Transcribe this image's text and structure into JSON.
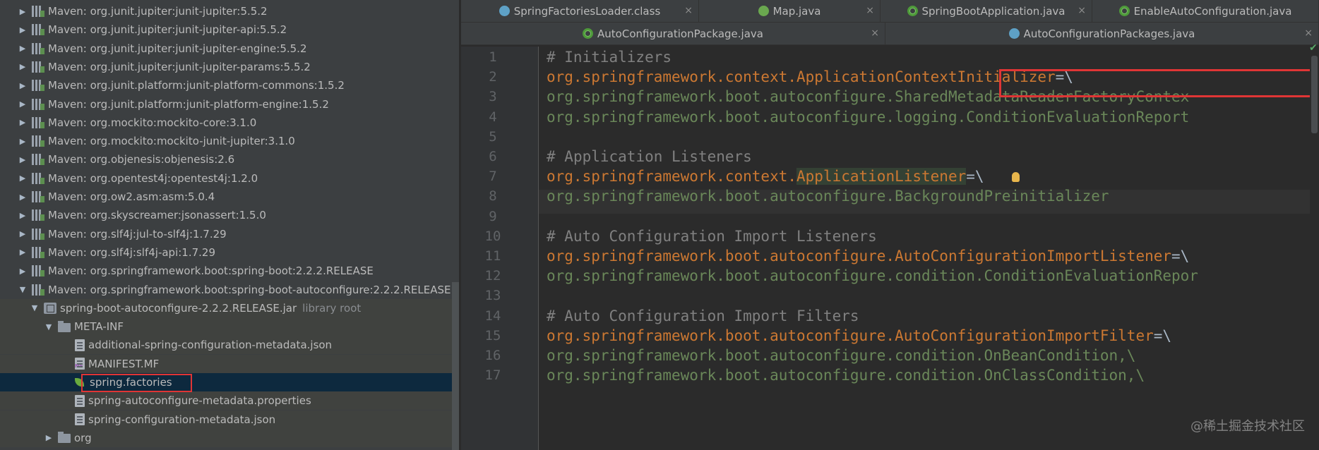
{
  "project_tree": {
    "rows": [
      {
        "label": "Maven: org.junit.jupiter:junit-jupiter:5.5.2",
        "depth": 1,
        "arrow": "▶",
        "icon": "library-icon"
      },
      {
        "label": "Maven: org.junit.jupiter:junit-jupiter-api:5.5.2",
        "depth": 1,
        "arrow": "▶",
        "icon": "library-icon"
      },
      {
        "label": "Maven: org.junit.jupiter:junit-jupiter-engine:5.5.2",
        "depth": 1,
        "arrow": "▶",
        "icon": "library-icon"
      },
      {
        "label": "Maven: org.junit.jupiter:junit-jupiter-params:5.5.2",
        "depth": 1,
        "arrow": "▶",
        "icon": "library-icon"
      },
      {
        "label": "Maven: org.junit.platform:junit-platform-commons:1.5.2",
        "depth": 1,
        "arrow": "▶",
        "icon": "library-icon"
      },
      {
        "label": "Maven: org.junit.platform:junit-platform-engine:1.5.2",
        "depth": 1,
        "arrow": "▶",
        "icon": "library-icon"
      },
      {
        "label": "Maven: org.mockito:mockito-core:3.1.0",
        "depth": 1,
        "arrow": "▶",
        "icon": "library-icon"
      },
      {
        "label": "Maven: org.mockito:mockito-junit-jupiter:3.1.0",
        "depth": 1,
        "arrow": "▶",
        "icon": "library-icon"
      },
      {
        "label": "Maven: org.objenesis:objenesis:2.6",
        "depth": 1,
        "arrow": "▶",
        "icon": "library-icon"
      },
      {
        "label": "Maven: org.opentest4j:opentest4j:1.2.0",
        "depth": 1,
        "arrow": "▶",
        "icon": "library-icon"
      },
      {
        "label": "Maven: org.ow2.asm:asm:5.0.4",
        "depth": 1,
        "arrow": "▶",
        "icon": "library-icon"
      },
      {
        "label": "Maven: org.skyscreamer:jsonassert:1.5.0",
        "depth": 1,
        "arrow": "▶",
        "icon": "library-icon"
      },
      {
        "label": "Maven: org.slf4j:jul-to-slf4j:1.7.29",
        "depth": 1,
        "arrow": "▶",
        "icon": "library-icon"
      },
      {
        "label": "Maven: org.slf4j:slf4j-api:1.7.29",
        "depth": 1,
        "arrow": "▶",
        "icon": "library-icon"
      },
      {
        "label": "Maven: org.springframework.boot:spring-boot:2.2.2.RELEASE",
        "depth": 1,
        "arrow": "▶",
        "icon": "library-icon"
      },
      {
        "label": "Maven: org.springframework.boot:spring-boot-autoconfigure:2.2.2.RELEASE",
        "depth": 1,
        "arrow": "▼",
        "icon": "library-icon"
      },
      {
        "label": "spring-boot-autoconfigure-2.2.2.RELEASE.jar",
        "suffix": "library root",
        "depth": 2,
        "arrow": "▼",
        "icon": "jar-icon"
      },
      {
        "label": "META-INF",
        "depth": 3,
        "arrow": "▼",
        "icon": "folder-icon"
      },
      {
        "label": "additional-spring-configuration-metadata.json",
        "depth": 4,
        "arrow": "",
        "icon": "json-file-icon"
      },
      {
        "label": "MANIFEST.MF",
        "depth": 4,
        "arrow": "",
        "icon": "manifest-file-icon"
      },
      {
        "label": "spring.factories",
        "depth": 4,
        "arrow": "",
        "icon": "spring-leaf-icon",
        "selected": true
      },
      {
        "label": "spring-autoconfigure-metadata.properties",
        "depth": 4,
        "arrow": "",
        "icon": "properties-file-icon"
      },
      {
        "label": "spring-configuration-metadata.json",
        "depth": 4,
        "arrow": "",
        "icon": "json-file-icon"
      },
      {
        "label": "org",
        "depth": 3,
        "arrow": "▶",
        "icon": "package-folder-icon"
      }
    ]
  },
  "editor_tabs": {
    "row1": [
      {
        "label": "SpringFactoriesLoader.class",
        "icon": "class-icon",
        "close": "×"
      },
      {
        "label": "Map.java",
        "icon": "interface-icon",
        "close": "×"
      },
      {
        "label": "SpringBootApplication.java",
        "icon": "spring-annotation-icon",
        "close": "×"
      },
      {
        "label": "EnableAutoConfiguration.java",
        "icon": "spring-annotation-icon",
        "close": ""
      }
    ],
    "row2": [
      {
        "label": "AutoConfigurationPackage.java",
        "icon": "spring-annotation-icon",
        "close": "×"
      },
      {
        "label": "AutoConfigurationPackages.java",
        "icon": "class-icon",
        "close": "×"
      }
    ]
  },
  "code_lines": [
    {
      "n": "1",
      "parts": [
        {
          "t": "# Initializers",
          "c": "comment"
        }
      ]
    },
    {
      "n": "2",
      "parts": [
        {
          "t": "org.springframework.context.ApplicationContextInitializer",
          "c": "key"
        },
        {
          "t": "=\\",
          "c": "op"
        }
      ]
    },
    {
      "n": "3",
      "parts": [
        {
          "t": "org.springframework.boot.autoconfigure.SharedMetadataReaderFactoryContex",
          "c": "val"
        }
      ]
    },
    {
      "n": "4",
      "parts": [
        {
          "t": "org.springframework.boot.autoconfigure.logging.ConditionEvaluationReport",
          "c": "val"
        }
      ]
    },
    {
      "n": "5",
      "parts": []
    },
    {
      "n": "6",
      "parts": [
        {
          "t": "# ",
          "c": "comment"
        },
        {
          "t": "Application Listeners",
          "c": "comment"
        }
      ]
    },
    {
      "n": "7",
      "parts": [
        {
          "t": "org.springframework.context.",
          "c": "key"
        },
        {
          "t": "ApplicationListener",
          "c": "key",
          "hl": true
        },
        {
          "t": "=\\",
          "c": "op"
        }
      ]
    },
    {
      "n": "8",
      "parts": [
        {
          "t": "org.springframework.boot.autoconfigure.BackgroundPreinitializer",
          "c": "val"
        }
      ]
    },
    {
      "n": "9",
      "parts": []
    },
    {
      "n": "10",
      "parts": [
        {
          "t": "# Auto Configuration Import Listeners",
          "c": "comment"
        }
      ]
    },
    {
      "n": "11",
      "parts": [
        {
          "t": "org.springframework.boot.autoconfigure.AutoConfigurationImportListener",
          "c": "key"
        },
        {
          "t": "=\\",
          "c": "op"
        }
      ]
    },
    {
      "n": "12",
      "parts": [
        {
          "t": "org.springframework.boot.autoconfigure.condition.ConditionEvaluationRepor",
          "c": "val"
        }
      ]
    },
    {
      "n": "13",
      "parts": []
    },
    {
      "n": "14",
      "parts": [
        {
          "t": "# Auto Configuration Import Filters",
          "c": "comment"
        }
      ]
    },
    {
      "n": "15",
      "parts": [
        {
          "t": "org.springframework.boot.autoconfigure.AutoConfigurationImportFilter",
          "c": "key"
        },
        {
          "t": "=\\",
          "c": "op"
        }
      ]
    },
    {
      "n": "16",
      "parts": [
        {
          "t": "org.springframework.boot.autoconfigure.condition.OnBeanCondition,\\",
          "c": "val"
        }
      ]
    },
    {
      "n": "17",
      "parts": [
        {
          "t": "org.springframework.boot.autoconfigure.condition.OnClassCondition,\\",
          "c": "val"
        }
      ]
    }
  ],
  "editor_status": {
    "check_icon": "✔"
  },
  "watermark": "@稀土掘金技术社区",
  "colors": {
    "key": "#cc7832",
    "value": "#6a8759",
    "comment": "#808080",
    "selection": "#0d293e",
    "highlight_box": "#e03535"
  }
}
